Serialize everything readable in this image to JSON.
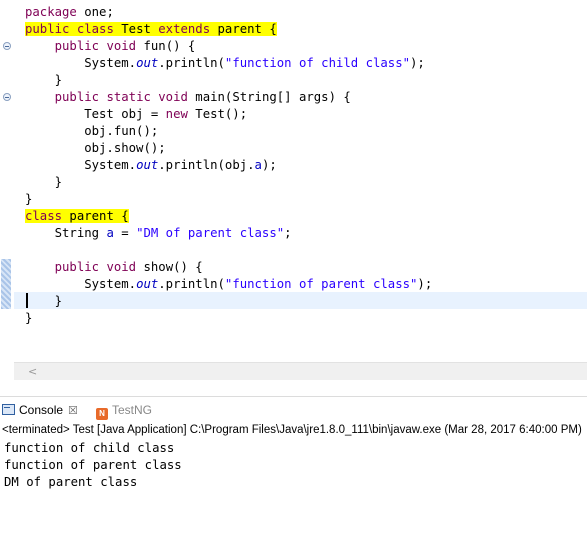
{
  "editor": {
    "code_lines": [
      "package one;",
      "public class Test extends parent {",
      "    public void fun() {",
      "        System.out.println(\"function of child class\");",
      "    }",
      "    public static void main(String[] args) {",
      "        Test obj = new Test();",
      "        obj.fun();",
      "        obj.show();",
      "        System.out.println(obj.a);",
      "    }",
      "}",
      "class parent {",
      "    String a = \"DM of parent class\";",
      "",
      "    public void show() {",
      "        System.out.println(\"function of parent class\");",
      "    }",
      "}"
    ],
    "highlight_color": "#ffff00",
    "keyword_color": "#7f0055",
    "string_color": "#2a00ff"
  },
  "scrollbar": {
    "left_arrow_icon": "chevron-left-icon",
    "left_arrow": "<"
  },
  "console": {
    "tabs": [
      {
        "label": "Console",
        "icon": "console-icon",
        "active": true
      },
      {
        "label": "TestNG",
        "icon": "testng-icon",
        "active": false
      }
    ],
    "close_glyph": "☒",
    "testng_glyph": "N",
    "header": "<terminated> Test [Java Application] C:\\Program Files\\Java\\jre1.8.0_111\\bin\\javaw.exe (Mar 28, 2017 6:40:00 PM)",
    "output_lines": [
      "function of child class",
      "function of parent class",
      "DM of parent class"
    ]
  }
}
